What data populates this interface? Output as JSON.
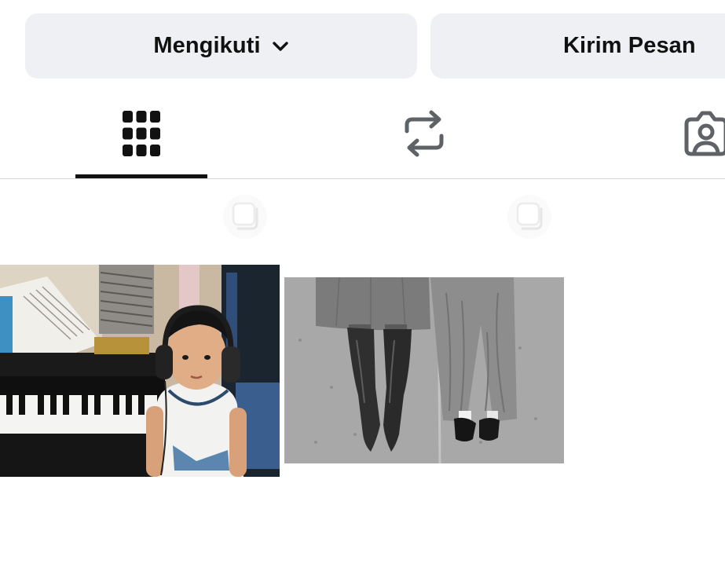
{
  "actions": {
    "follow_label": "Mengikuti",
    "message_label": "Kirim Pesan"
  },
  "icons": {
    "follow_dropdown": "chevron-down-icon",
    "tab_grid": "grid-icon",
    "tab_reposts": "repost-icon",
    "tab_tagged": "tagged-person-icon",
    "multi_post": "multi-post-icon"
  },
  "tabs": [
    {
      "name": "posts",
      "icon": "grid-icon",
      "selected": true
    },
    {
      "name": "reposts",
      "icon": "repost-icon",
      "selected": false
    },
    {
      "name": "tagged",
      "icon": "tagged-person-icon",
      "selected": false
    }
  ],
  "colors": {
    "button_bg": "#eff0f4",
    "text": "#111111",
    "inactive_icon": "#5f6368",
    "active_indicator": "#111111",
    "divider": "#d8d8d8"
  },
  "posts": [
    {
      "kind": "photo",
      "subject": "child-with-headphones-at-piano"
    },
    {
      "kind": "photo",
      "subject": "black-and-white-boots-and-jeans"
    }
  ]
}
